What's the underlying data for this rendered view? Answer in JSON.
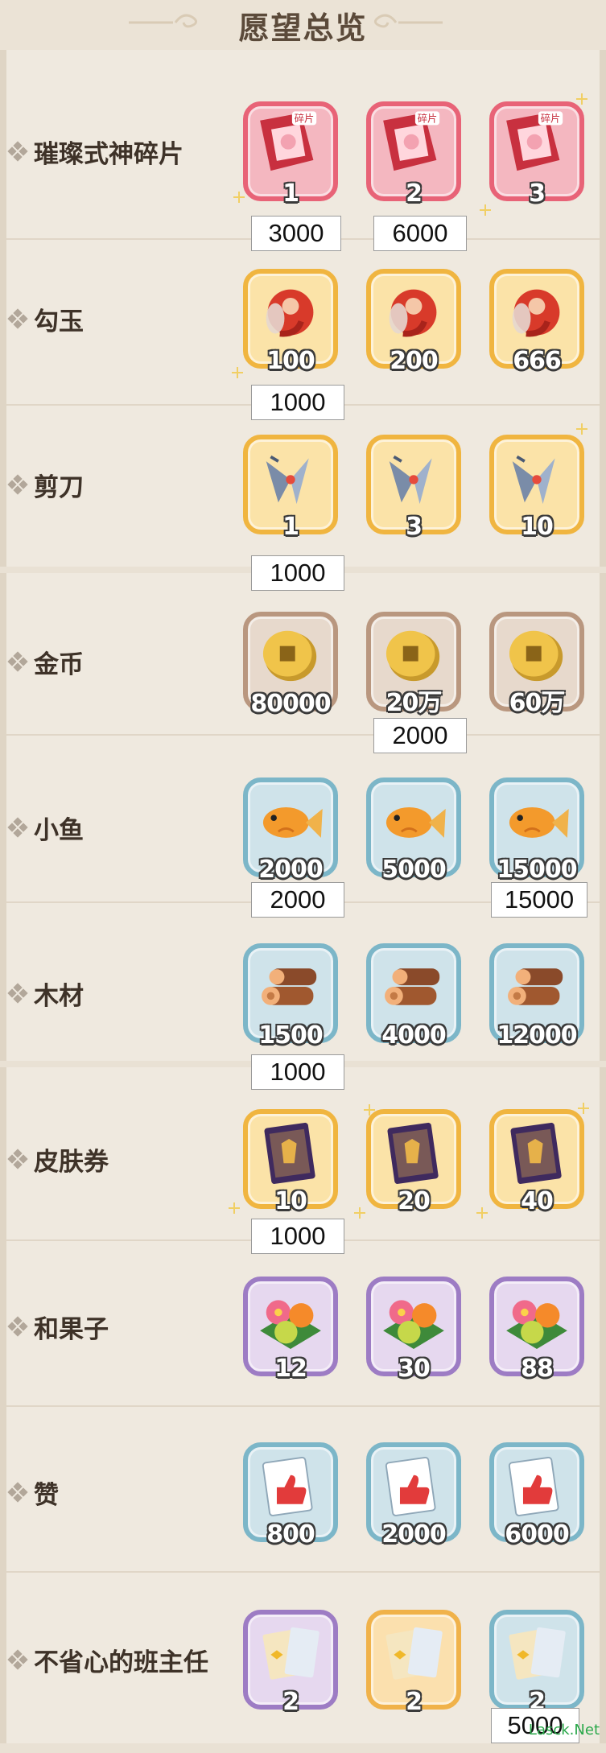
{
  "header": {
    "title": "愿望总览"
  },
  "rows": [
    {
      "label": "璀璨式神碎片",
      "theme": "red",
      "icon": "shard-card-icon",
      "counts": [
        "1",
        "2",
        "3"
      ]
    },
    {
      "label": "勾玉",
      "theme": "gold",
      "icon": "magatama-icon",
      "counts": [
        "100",
        "200",
        "666"
      ]
    },
    {
      "label": "剪刀",
      "theme": "gold",
      "icon": "scissors-icon",
      "counts": [
        "1",
        "3",
        "10"
      ]
    },
    {
      "label": "金币",
      "theme": "bronze",
      "icon": "coin-icon",
      "counts": [
        "80000",
        "20万",
        "60万"
      ]
    },
    {
      "label": "小鱼",
      "theme": "blue",
      "icon": "fish-icon",
      "counts": [
        "2000",
        "5000",
        "15000"
      ]
    },
    {
      "label": "木材",
      "theme": "blue",
      "icon": "wood-icon",
      "counts": [
        "1500",
        "4000",
        "12000"
      ]
    },
    {
      "label": "皮肤券",
      "theme": "gold",
      "icon": "skin-ticket-icon",
      "counts": [
        "10",
        "20",
        "40"
      ]
    },
    {
      "label": "和果子",
      "theme": "purple",
      "icon": "wagashi-icon",
      "counts": [
        "12",
        "30",
        "88"
      ]
    },
    {
      "label": "赞",
      "theme": "blue",
      "icon": "like-card-icon",
      "counts": [
        "800",
        "2000",
        "6000"
      ]
    },
    {
      "label": "不省心的班主任",
      "theme": "mixed",
      "icon": "letter-icon",
      "counts": [
        "2",
        "2",
        "2"
      ]
    }
  ],
  "notes": [
    {
      "text": "3000"
    },
    {
      "text": "6000"
    },
    {
      "text": "1000"
    },
    {
      "text": "1000"
    },
    {
      "text": "2000"
    },
    {
      "text": "2000"
    },
    {
      "text": "15000"
    },
    {
      "text": "1000"
    },
    {
      "text": "1000"
    },
    {
      "text": "5000"
    }
  ],
  "watermark": "Lasck.Net",
  "colors": {
    "background": "#e9e1d4",
    "label_text": "#3e3228",
    "red_border": "#e86377",
    "gold_border": "#f0b540",
    "bronze_border": "#b9977f",
    "blue_border": "#7cb6c8",
    "purple_border": "#9d7cc4"
  }
}
